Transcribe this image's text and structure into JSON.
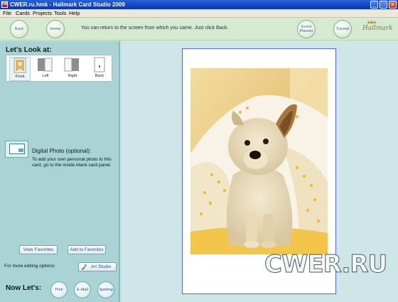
{
  "window": {
    "title": "CWER.ru.hmk - Hallmark Card Studio 2009",
    "app_icon_text": "HM",
    "controls": {
      "minimize": "_",
      "maximize": "□",
      "close": "×"
    }
  },
  "menu": [
    "File",
    "Cards",
    "Projects",
    "Tools",
    "Help"
  ],
  "toolbar": {
    "back_label": "Back",
    "home_label": "Home",
    "hint": "You can return to the screen from which you came.  Just click Back.",
    "event_planner_label": "Event Planner",
    "tutorial_label": "Tutorial",
    "brand": "Hallmark"
  },
  "left": {
    "look_title": "Let's Look at:",
    "panels": [
      {
        "label": "Front",
        "selected": true
      },
      {
        "label": "Left",
        "selected": false
      },
      {
        "label": "Right",
        "selected": false
      },
      {
        "label": "Back",
        "selected": false
      }
    ],
    "digital_photo_title": "Digital Photo (optional):",
    "digital_photo_desc": "To add your own personal photo to this card, go to the inside blank card panel.",
    "view_favorites": "View Favorites",
    "add_favorites": "Add to Favorites",
    "more_options": "For more editing options:",
    "art_studio": "Art Studio",
    "now_lets": "Now Let's:",
    "actions": [
      "Print",
      "E-Mail",
      "Spelling"
    ]
  },
  "watermark": "CWER.RU",
  "colors": {
    "title_bar": "#1246c4",
    "left_panel": "#a9d3d5",
    "main_bg": "#cfe6e8",
    "card_border": "#5a64c8",
    "button_text": "#2b4f8a"
  }
}
